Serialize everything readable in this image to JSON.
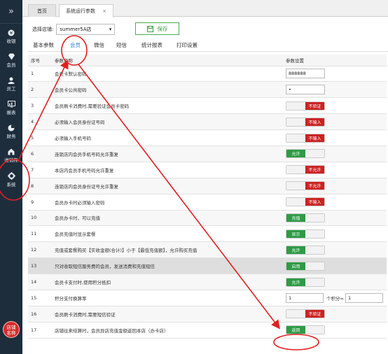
{
  "sidebar": {
    "items": [
      {
        "label": "收银",
        "icon": "cashier-icon"
      },
      {
        "label": "会员",
        "icon": "member-icon"
      },
      {
        "label": "员工",
        "icon": "staff-icon"
      },
      {
        "label": "报表",
        "icon": "report-icon"
      },
      {
        "label": "财务",
        "icon": "finance-icon"
      },
      {
        "label": "进销存",
        "icon": "inventory-icon"
      },
      {
        "label": "系统",
        "icon": "gear-icon"
      }
    ],
    "store_badge_line1": "店铺",
    "store_badge_line2": "名称"
  },
  "tabs": [
    {
      "label": "首页"
    },
    {
      "label": "系统运行参数",
      "close": "×"
    }
  ],
  "toolbar": {
    "store_label": "选择店铺:",
    "store_value": "summer5A店",
    "save_label": "保存"
  },
  "subtabs": [
    "基本参数",
    "会员",
    "微信",
    "短信",
    "统计报表",
    "打印设置"
  ],
  "table": {
    "headers": [
      "序号",
      "参数名称",
      "参数设置"
    ],
    "rows": [
      {
        "no": "1",
        "name": "会员卡默认密码",
        "type": "input",
        "value": "888888"
      },
      {
        "no": "2",
        "name": "会员卡公共密码",
        "type": "input",
        "value": "•"
      },
      {
        "no": "3",
        "name": "会员刷卡消费时,需要验证会员卡密码",
        "type": "off",
        "value": "不验证"
      },
      {
        "no": "4",
        "name": "必须输入会员身份证号码",
        "type": "off",
        "value": "不输入"
      },
      {
        "no": "5",
        "name": "必须输入手机号码",
        "type": "off",
        "value": "不输入"
      },
      {
        "no": "6",
        "name": "连锁店内会员手机号码允许重复",
        "type": "on",
        "value": "允许"
      },
      {
        "no": "7",
        "name": "本店内会员手机号码允许重复",
        "type": "off",
        "value": "不允许"
      },
      {
        "no": "8",
        "name": "连锁店内会员身份证号允许重复",
        "type": "off",
        "value": "不允许"
      },
      {
        "no": "9",
        "name": "会员办卡时必须输入密码",
        "type": "off",
        "value": "不输入"
      },
      {
        "no": "10",
        "name": "会员办卡时，可以充值",
        "type": "on",
        "value": "充值"
      },
      {
        "no": "11",
        "name": "会员充值时显示套餐",
        "type": "on",
        "value": "显示"
      },
      {
        "no": "12",
        "name": "充值或套餐购买【实收金额(合计)】小于【最低充值额】，允许购买充值",
        "type": "on",
        "value": "允许"
      },
      {
        "no": "13",
        "name": "只对收取短信服务费的会员，发送消费和充值短信",
        "type": "on",
        "value": "启用"
      },
      {
        "no": "14",
        "name": "会员卡支付时,使用积分抵扣",
        "type": "on",
        "value": "允许"
      },
      {
        "no": "15",
        "name": "积分支付换算率",
        "type": "pair",
        "value": "1",
        "sep": "个积分=",
        "value2": "1"
      },
      {
        "no": "16",
        "name": "会员刷卡消费时,需要短信验证",
        "type": "off",
        "value": "不验证"
      },
      {
        "no": "17",
        "name": "店铺往来结算时，会员异店充值金额返回本店（办卡店）",
        "type": "on",
        "value": "返回"
      }
    ]
  },
  "colors": {
    "sidebar_bg": "#1d2d3c",
    "toggle_on": "#2e9b45",
    "toggle_off": "#cc2222",
    "annotation": "#e02020",
    "active_tab": "#2a7fd4"
  }
}
